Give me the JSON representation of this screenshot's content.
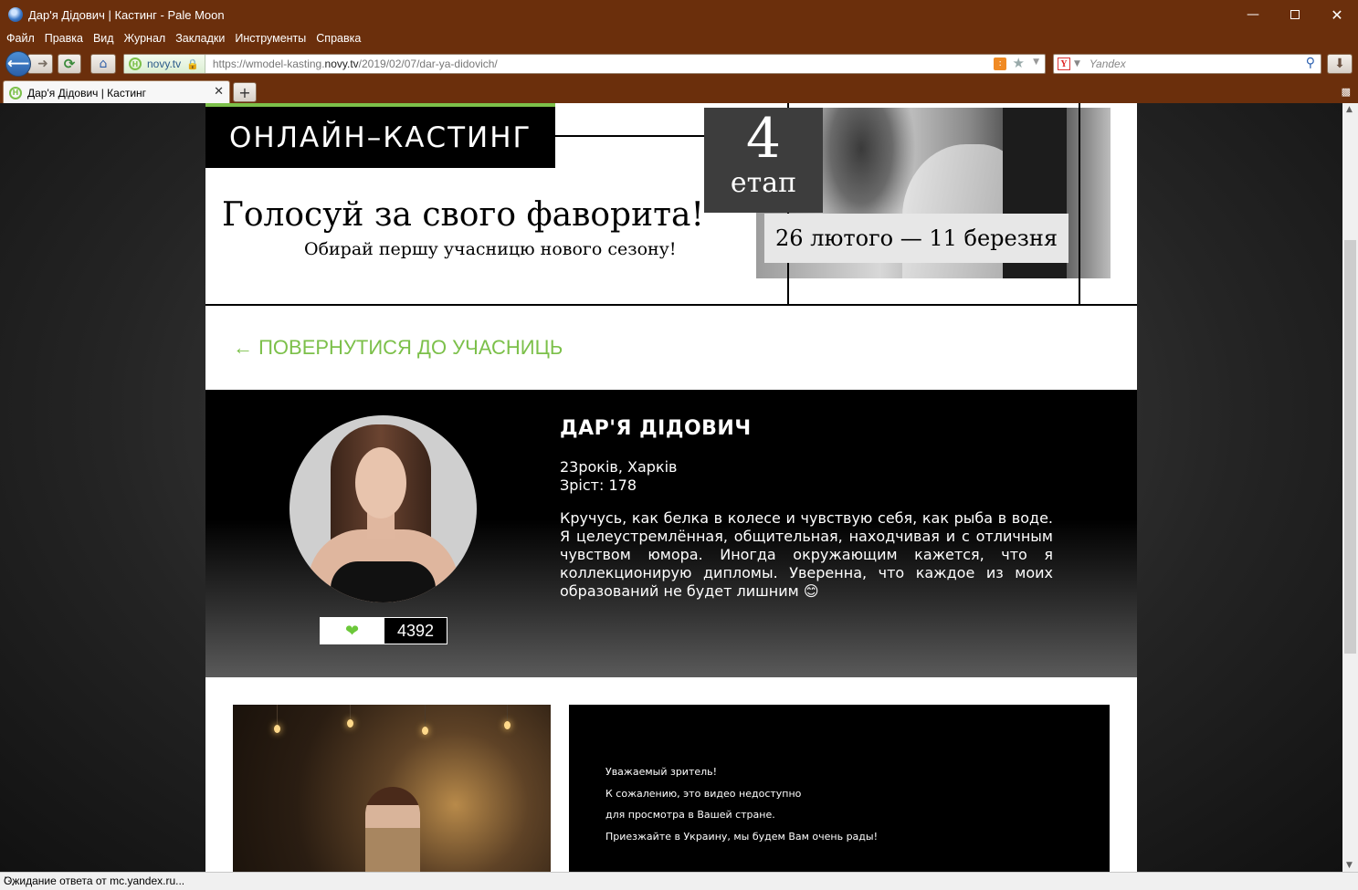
{
  "window": {
    "title": "Дар'я Дідович | Кастинг - Pale Moon"
  },
  "menu": [
    "Файл",
    "Правка",
    "Вид",
    "Журнал",
    "Закладки",
    "Инструменты",
    "Справка"
  ],
  "nav": {
    "identity": "novy.tv",
    "url_prefix": "https://wmodel-kasting.",
    "url_domain": "novy.tv",
    "url_path": "/2019/02/07/dar-ya-didovich/",
    "search_placeholder": "Yandex"
  },
  "tab": {
    "title": "Дар'я Дідович | Кастинг"
  },
  "banner": {
    "casting_label": "ОНЛАЙН–КАСТИНГ",
    "stage_number": "4",
    "stage_word": "етап",
    "dates": "26 лютого — 11 березня",
    "vote_title": "Голосуй за свого фаворита!",
    "vote_subtitle": "Обирай першу учасницю нового сезону!"
  },
  "back_link": "← ПОВЕРНУТИСЯ ДО УЧАСНИЦЬ",
  "profile": {
    "name": "ДАР'Я ДІДОВИЧ",
    "age_city": "23років, Харків",
    "height": "Зріст: 178",
    "bio": "Кручусь, как белка в колесе и чувствую себя, как рыба в воде. Я целеустремлённая, общительная, находчивая и с отличным чувством юмора. Иногда окружающим кажется, что я коллекционирую дипломы. Уверенна, что каждое из моих образований не будет лишним 😊",
    "likes": "4392"
  },
  "video_message": {
    "line1": "Уважаемый зритель!",
    "line2": "К сожалению, это видео недоступно",
    "line3": "для просмотра в Вашей стране.",
    "line4": "Приезжайте в Украину, мы будем Вам очень рады!"
  },
  "status": "Ожидание ответа от mc.yandex.ru...",
  "colors": {
    "chrome": "#6b2f0c",
    "accent_green": "#7cc04a"
  }
}
